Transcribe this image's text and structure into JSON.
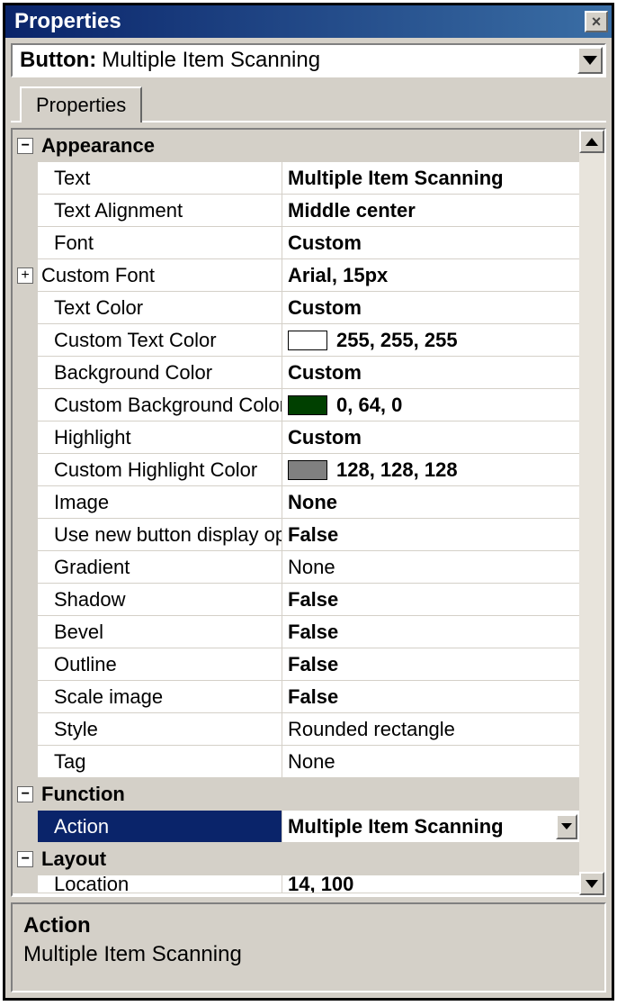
{
  "window": {
    "title": "Properties"
  },
  "object": {
    "prefix": "Button:",
    "name": "Multiple Item Scanning"
  },
  "tabs": {
    "properties": "Properties"
  },
  "categories": {
    "appearance": "Appearance",
    "function": "Function",
    "layout": "Layout"
  },
  "props": {
    "text": {
      "label": "Text",
      "value": "Multiple Item Scanning",
      "bold": true
    },
    "textAlign": {
      "label": "Text Alignment",
      "value": "Middle center",
      "bold": true
    },
    "font": {
      "label": "Font",
      "value": "Custom",
      "bold": true
    },
    "customFont": {
      "label": "Custom Font",
      "value": "Arial, 15px",
      "bold": true,
      "expandable": true
    },
    "textColor": {
      "label": "Text Color",
      "value": "Custom",
      "bold": true
    },
    "customTextColor": {
      "label": "Custom Text Color",
      "value": "255, 255, 255",
      "bold": true,
      "swatch": "#ffffff"
    },
    "bgColor": {
      "label": "Background Color",
      "value": "Custom",
      "bold": true
    },
    "customBgColor": {
      "label": "Custom Background Color",
      "value": "0, 64, 0",
      "bold": true,
      "swatch": "#004000"
    },
    "highlight": {
      "label": "Highlight",
      "value": "Custom",
      "bold": true
    },
    "customHighlight": {
      "label": "Custom Highlight Color",
      "value": "128, 128, 128",
      "bold": true,
      "swatch": "#808080"
    },
    "image": {
      "label": "Image",
      "value": "None",
      "bold": true
    },
    "useNewDisplay": {
      "label": "Use new button display options",
      "value": "False",
      "bold": true
    },
    "gradient": {
      "label": "Gradient",
      "value": "None",
      "bold": false
    },
    "shadow": {
      "label": "Shadow",
      "value": "False",
      "bold": true
    },
    "bevel": {
      "label": "Bevel",
      "value": "False",
      "bold": true
    },
    "outline": {
      "label": "Outline",
      "value": "False",
      "bold": true
    },
    "scaleImage": {
      "label": "Scale image",
      "value": "False",
      "bold": true
    },
    "style": {
      "label": "Style",
      "value": "Rounded rectangle",
      "bold": false
    },
    "tag": {
      "label": "Tag",
      "value": "None",
      "bold": false
    },
    "action": {
      "label": "Action",
      "value": "Multiple Item Scanning",
      "bold": true
    },
    "location": {
      "label": "Location",
      "value": "14, 100",
      "bold": true
    }
  },
  "desc": {
    "title": "Action",
    "text": "Multiple Item Scanning"
  },
  "glyphs": {
    "plus": "+",
    "minus": "−"
  }
}
